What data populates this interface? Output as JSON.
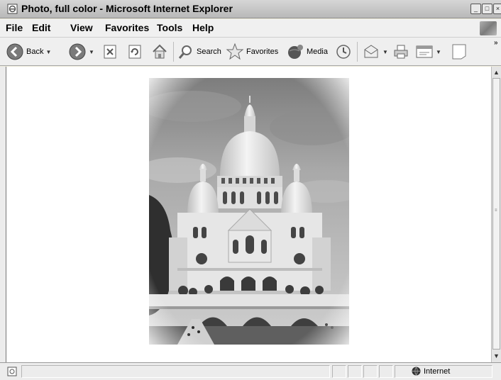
{
  "window": {
    "title": "Photo, full color - Microsoft Internet Explorer"
  },
  "menu": [
    {
      "label": "File"
    },
    {
      "label": "Edit"
    },
    {
      "label": "View"
    },
    {
      "label": "Favorites"
    },
    {
      "label": "Tools"
    },
    {
      "label": "Help"
    }
  ],
  "toolbar": {
    "back_label": "Back",
    "search_label": "Search",
    "favorites_label": "Favorites",
    "media_label": "Media"
  },
  "status": {
    "zone_label": "Internet"
  },
  "icons": {
    "title": "ie-page-icon",
    "back": "back-arrow-icon",
    "forward": "forward-arrow-icon",
    "stop": "stop-icon",
    "refresh": "refresh-icon",
    "home": "home-icon",
    "search": "magnifier-icon",
    "favorites": "star-icon",
    "media": "media-globe-icon",
    "history": "history-icon",
    "mail": "mail-icon",
    "print": "printer-icon",
    "edit": "edit-icon",
    "discuss": "note-icon",
    "zone": "internet-globe-icon"
  }
}
